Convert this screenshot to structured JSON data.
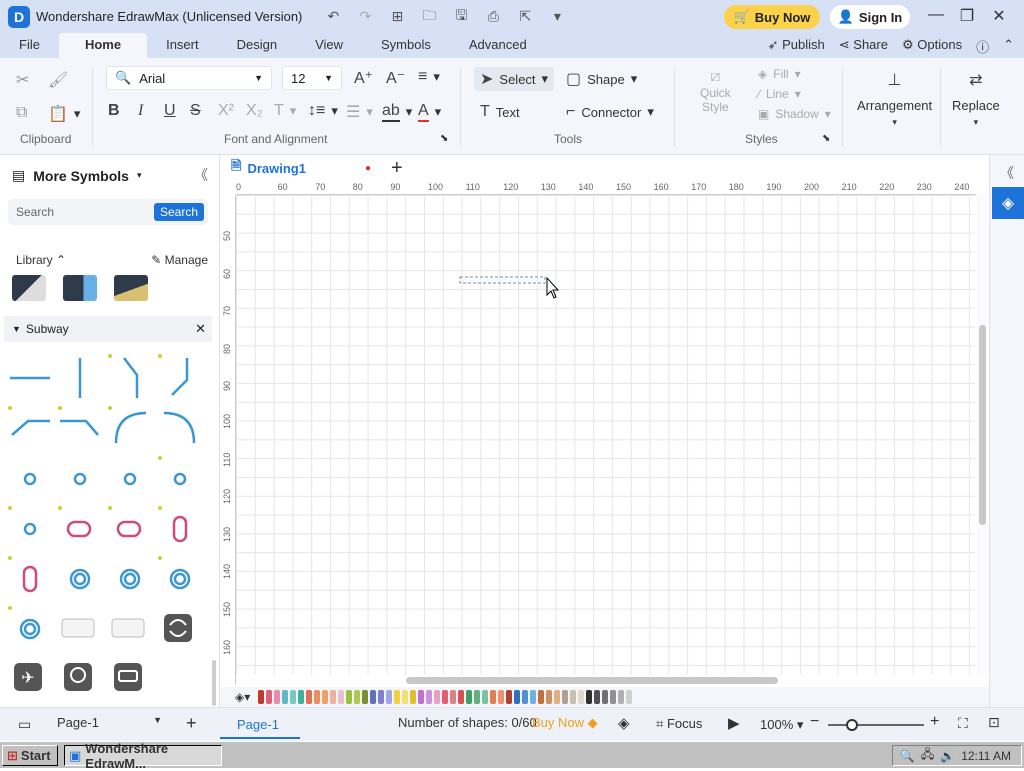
{
  "titlebar": {
    "title": "Wondershare EdrawMax (Unlicensed Version)",
    "buy_now": "Buy Now",
    "sign_in": "Sign In"
  },
  "menubar": {
    "items": [
      "File",
      "Home",
      "Insert",
      "Design",
      "View",
      "Symbols",
      "Advanced"
    ],
    "active": "Home",
    "right": {
      "publish": "Publish",
      "share": "Share",
      "options": "Options"
    }
  },
  "ribbon": {
    "clipboard_label": "Clipboard",
    "font": {
      "name": "Arial",
      "size": "12",
      "label": "Font and Alignment"
    },
    "tools": {
      "select": "Select",
      "shape": "Shape",
      "text": "Text",
      "connector": "Connector",
      "label": "Tools"
    },
    "styles": {
      "quick_style_1": "Quick",
      "quick_style_2": "Style",
      "fill": "Fill",
      "line": "Line",
      "shadow": "Shadow",
      "label": "Styles"
    },
    "arrangement": "Arrangement",
    "replace": "Replace"
  },
  "leftpanel": {
    "header": "More Symbols",
    "search_placeholder": "Search",
    "search_button": "Search",
    "library": "Library",
    "manage": "Manage",
    "category": "Subway"
  },
  "canvas": {
    "doc_tab": "Drawing1",
    "hruler": [
      "0",
      "60",
      "70",
      "80",
      "90",
      "100",
      "110",
      "120",
      "130",
      "140",
      "150",
      "160",
      "170",
      "180",
      "190",
      "200",
      "210",
      "220",
      "230",
      "240"
    ],
    "vruler": [
      "50",
      "60",
      "70",
      "80",
      "90",
      "100",
      "110",
      "120",
      "130",
      "140",
      "150",
      "160"
    ]
  },
  "statusbar": {
    "page_select": "Page-1",
    "page_tab": "Page-1",
    "shapes": "Number of shapes: 0/60",
    "buy_now": "Buy Now",
    "focus": "Focus",
    "zoom": "100%"
  },
  "taskbar": {
    "start": "Start",
    "task": "Wondershare EdrawM...",
    "time": "12:11 AM"
  },
  "colors": {
    "accent": "#1e73d8",
    "buy_now_bg": "#fbd24a"
  }
}
